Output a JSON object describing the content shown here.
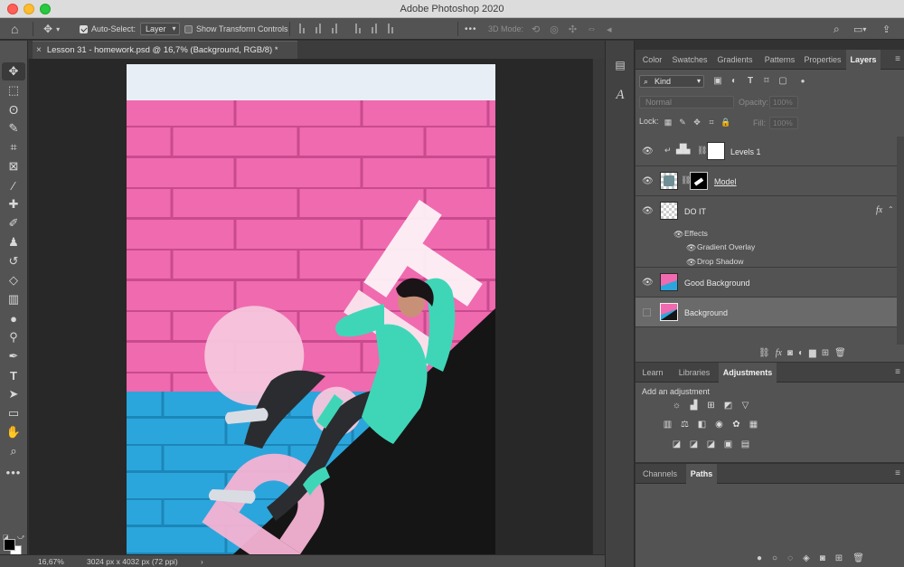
{
  "app": {
    "title": "Adobe Photoshop 2020"
  },
  "options_bar": {
    "auto_select_label": "Auto-Select:",
    "auto_select_value": "Layer",
    "show_transform_label": "Show Transform Controls",
    "mode_3d_label": "3D Mode:",
    "more_label": "•••"
  },
  "document": {
    "tab_label": "Lesson 31 - homework.psd @ 16,7% (Background, RGB/8) *",
    "close_glyph": "×"
  },
  "artwork": {
    "text": "DO IT"
  },
  "status": {
    "zoom": "16,67%",
    "doc_info": "3024 px x 4032 px (72 ppi)",
    "arrow": "›"
  },
  "panels_top": {
    "tabs": [
      "Color",
      "Swatches",
      "Gradients",
      "Patterns",
      "Properties",
      "Layers"
    ],
    "active_tab": "Layers"
  },
  "layers_panel": {
    "kind_label": "Kind",
    "blend_mode": "Normal",
    "opacity_label": "Opacity:",
    "opacity_value": "100%",
    "lock_label": "Lock:",
    "fill_label": "Fill:",
    "fill_value": "100%",
    "layers": [
      {
        "name": "Levels 1",
        "visible": true
      },
      {
        "name": "Model",
        "visible": true
      },
      {
        "name": "DO IT",
        "visible": true,
        "fx": "fx"
      },
      {
        "name": "Good Background",
        "visible": true
      },
      {
        "name": "Background",
        "visible": false
      }
    ],
    "effects_label": "Effects",
    "effects": [
      "Gradient Overlay",
      "Drop Shadow"
    ]
  },
  "panels_mid": {
    "tabs": [
      "Learn",
      "Libraries",
      "Adjustments"
    ],
    "active_tab": "Adjustments",
    "add_adjustment_label": "Add an adjustment"
  },
  "panels_bottom": {
    "tabs": [
      "Channels",
      "Paths"
    ],
    "active_tab": "Paths"
  },
  "colors": {
    "pink_wall": "#f06aaf",
    "blue_wall": "#2ba6dc",
    "black_wedge": "#151515",
    "text_pink": "#f6b3d3",
    "outfit_teal": "#3fd6b7"
  }
}
